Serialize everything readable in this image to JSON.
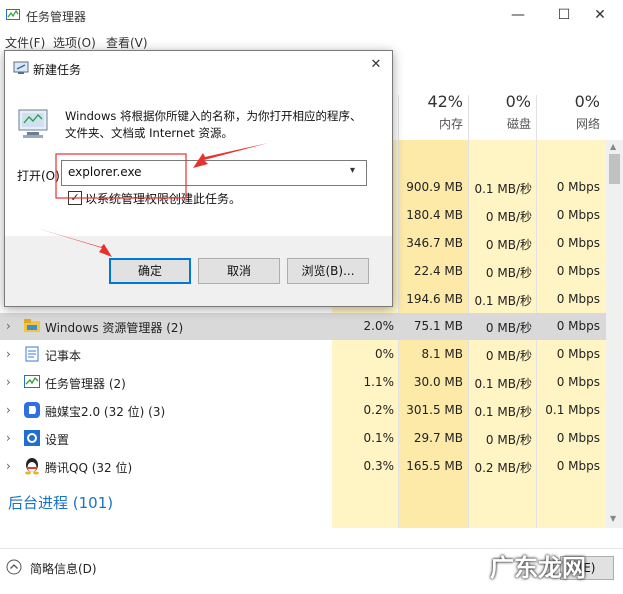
{
  "window": {
    "title": "任务管理器",
    "minimize": "—",
    "maximize": "☐",
    "close": "✕"
  },
  "menu": {
    "file": "文件(F)",
    "options": "选项(O)",
    "view": "查看(V)"
  },
  "headers": {
    "memory": {
      "pct": "42%",
      "label": "内存"
    },
    "disk": {
      "pct": "0%",
      "label": "磁盘"
    },
    "network": {
      "pct": "0%",
      "label": "网络"
    }
  },
  "hidden_rows": [
    {
      "memory": "900.9 MB",
      "disk": "0.1 MB/秒",
      "network": "0 Mbps"
    },
    {
      "memory": "180.4 MB",
      "disk": "0 MB/秒",
      "network": "0 Mbps"
    },
    {
      "memory": "346.7 MB",
      "disk": "0 MB/秒",
      "network": "0 Mbps"
    },
    {
      "memory": "22.4 MB",
      "disk": "0 MB/秒",
      "network": "0 Mbps"
    },
    {
      "memory": "194.6 MB",
      "disk": "0.1 MB/秒",
      "network": "0 Mbps"
    }
  ],
  "rows": [
    {
      "name": "Windows 资源管理器 (2)",
      "icon": "explorer-icon",
      "cpu": "2.0%",
      "memory": "75.1 MB",
      "disk": "0 MB/秒",
      "network": "0 Mbps"
    },
    {
      "name": "记事本",
      "icon": "notepad-icon",
      "cpu": "0%",
      "memory": "8.1 MB",
      "disk": "0 MB/秒",
      "network": "0 Mbps"
    },
    {
      "name": "任务管理器 (2)",
      "icon": "taskmgr-icon",
      "cpu": "1.1%",
      "memory": "30.0 MB",
      "disk": "0.1 MB/秒",
      "network": "0 Mbps"
    },
    {
      "name": "融媒宝2.0 (32 位) (3)",
      "icon": "rongmeibao-icon",
      "cpu": "0.2%",
      "memory": "301.5 MB",
      "disk": "0.1 MB/秒",
      "network": "0.1 Mbps"
    },
    {
      "name": "设置",
      "icon": "settings-icon",
      "cpu": "0.1%",
      "memory": "29.7 MB",
      "disk": "0 MB/秒",
      "network": "0 Mbps"
    },
    {
      "name": "腾讯QQ (32 位)",
      "icon": "qq-icon",
      "cpu": "0.3%",
      "memory": "165.5 MB",
      "disk": "0.2 MB/秒",
      "network": "0 Mbps"
    }
  ],
  "section": {
    "background": "后台进程 (101)"
  },
  "footer": {
    "brief": "简略信息(D)",
    "end_task": "(E)"
  },
  "dialog": {
    "title": "新建任务",
    "close": "✕",
    "description_line1": "Windows 将根据你所键入的名称，为你打开相应的程序、",
    "description_line2": "文件夹、文档或 Internet 资源。",
    "open_label": "打开(O):",
    "open_value": "explorer.exe",
    "admin_checkbox_label": "以系统管理权限创建此任务。",
    "admin_checked": true,
    "ok": "确定",
    "cancel": "取消",
    "browse": "浏览(B)..."
  },
  "watermark": "广东龙网",
  "colors": {
    "heat_light": "#fff4c4",
    "heat_mid": "#fde9a8",
    "selected": "#d9d9d9",
    "accent": "#1a73c7",
    "annotation_red": "#e6322f"
  }
}
